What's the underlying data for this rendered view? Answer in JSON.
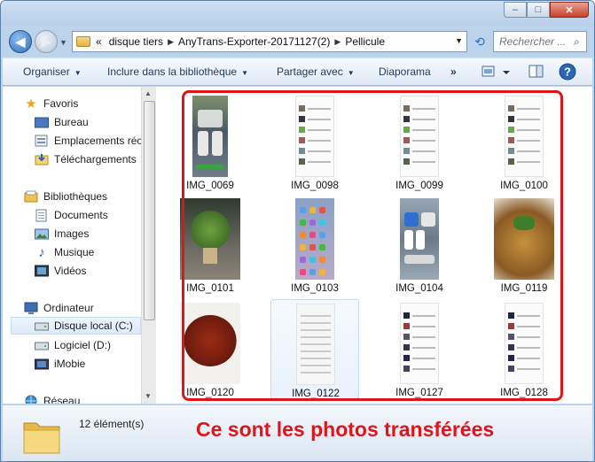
{
  "window": {
    "controls": {
      "minimize": "–",
      "maximize": "□",
      "close": "✕"
    }
  },
  "address": {
    "prefix": "«",
    "crumbs": [
      "disque tiers",
      "AnyTrans-Exporter-20171127(2)",
      "Pellicule"
    ],
    "search_placeholder": "Rechercher ..."
  },
  "toolbar": {
    "organize": "Organiser",
    "include": "Inclure dans la bibliothèque",
    "share": "Partager avec",
    "slideshow": "Diaporama",
    "more": "»"
  },
  "sidebar": {
    "favorites": {
      "header": "Favoris",
      "items": [
        "Bureau",
        "Emplacements réc",
        "Téléchargements"
      ]
    },
    "libraries": {
      "header": "Bibliothèques",
      "items": [
        "Documents",
        "Images",
        "Musique",
        "Vidéos"
      ]
    },
    "computer": {
      "header": "Ordinateur",
      "items": [
        "Disque local (C:)",
        "Logiciel (D:)",
        "iMobie"
      ]
    },
    "network": {
      "header": "Réseau"
    }
  },
  "files": [
    {
      "name": "IMG_0069",
      "kind": "controlcenter"
    },
    {
      "name": "IMG_0098",
      "kind": "messages"
    },
    {
      "name": "IMG_0099",
      "kind": "messages"
    },
    {
      "name": "IMG_0100",
      "kind": "messages"
    },
    {
      "name": "IMG_0101",
      "kind": "plant"
    },
    {
      "name": "IMG_0103",
      "kind": "homescreen"
    },
    {
      "name": "IMG_0104",
      "kind": "controlcenter2"
    },
    {
      "name": "IMG_0119",
      "kind": "food"
    },
    {
      "name": "IMG_0120",
      "kind": "soup"
    },
    {
      "name": "IMG_0122",
      "kind": "settings"
    },
    {
      "name": "IMG_0127",
      "kind": "messages2"
    },
    {
      "name": "IMG_0128",
      "kind": "messages2"
    }
  ],
  "status": {
    "count": "12 élément(s)"
  },
  "annotation": "Ce sont les photos transférées",
  "colors": {
    "annotation": "#e0141b",
    "window_frame": "#bcd3ec",
    "link_text": "#1e395b"
  }
}
